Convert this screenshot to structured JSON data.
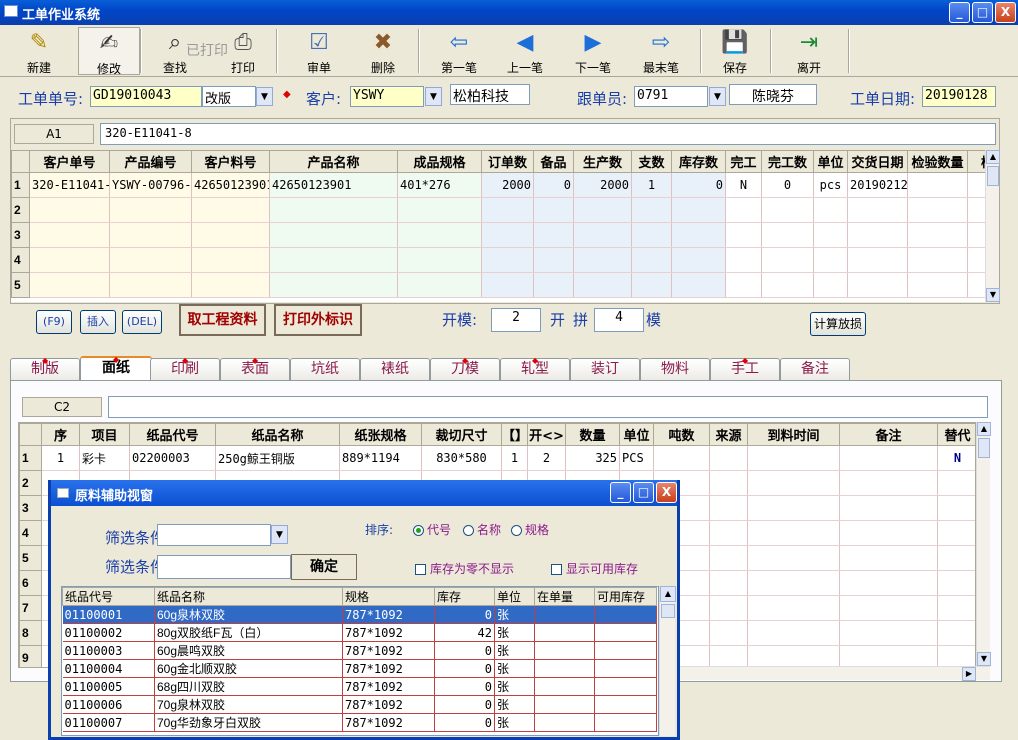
{
  "window": {
    "title": "工单作业系统",
    "minimize": "_",
    "maximize": "□",
    "close": "X"
  },
  "toolbar": [
    {
      "label": "新建",
      "icon": "new-icon"
    },
    {
      "label": "修改",
      "icon": "edit-icon"
    },
    {
      "label": "查找",
      "icon": "binoculars-icon"
    },
    {
      "label": "打印",
      "icon": "print-icon"
    },
    {
      "label": "审单",
      "icon": "review-icon"
    },
    {
      "label": "删除",
      "icon": "delete-icon"
    },
    {
      "label": "第一笔",
      "icon": "first-arrow-icon"
    },
    {
      "label": "上一笔",
      "icon": "prev-arrow-icon"
    },
    {
      "label": "下一笔",
      "icon": "next-arrow-icon"
    },
    {
      "label": "最末笔",
      "icon": "last-arrow-icon"
    },
    {
      "label": "保存",
      "icon": "save-icon"
    },
    {
      "label": "离开",
      "icon": "exit-icon"
    }
  ],
  "printed_watermark": "已打印",
  "header": {
    "order_no_label": "工单单号:",
    "order_no": "GD19010043",
    "mode": "改版",
    "customer_label": "客户:",
    "customer_code": "YSWY",
    "customer_name": "松柏科技",
    "follower_label": "跟单员:",
    "follower_code": "0791",
    "follower_name": "陈晓芬",
    "date_label": "工单日期:",
    "date": "20190128"
  },
  "top_grid": {
    "cell_ref": "A1",
    "cell_value": "320-E11041-8",
    "columns": [
      "",
      "客户单号",
      "产品编号",
      "客户料号",
      "产品名称",
      "成品规格",
      "订单数",
      "备品",
      "生产数",
      "支数",
      "库存数",
      "完工",
      "完工数",
      "单位",
      "交货日期",
      "检验数量",
      "检"
    ],
    "rows": [
      [
        "1",
        "320-E11041-",
        "YSWY-00796-",
        "42650123901",
        "42650123901",
        "401*276",
        "2000",
        "0",
        "2000",
        "1",
        "0",
        "N",
        "0",
        "pcs",
        "20190212",
        "",
        ""
      ],
      [
        "2",
        "",
        "",
        "",
        "",
        "",
        "",
        "",
        "",
        "",
        "",
        "",
        "",
        "",
        "",
        "",
        ""
      ],
      [
        "3",
        "",
        "",
        "",
        "",
        "",
        "",
        "",
        "",
        "",
        "",
        "",
        "",
        "",
        "",
        "",
        ""
      ],
      [
        "4",
        "",
        "",
        "",
        "",
        "",
        "",
        "",
        "",
        "",
        "",
        "",
        "",
        "",
        "",
        "",
        ""
      ],
      [
        "5",
        "",
        "",
        "",
        "",
        "",
        "",
        "",
        "",
        "",
        "",
        "",
        "",
        "",
        "",
        "",
        ""
      ]
    ]
  },
  "actions": {
    "f9": "(F9)",
    "insert": "插入",
    "del": "(DEL)",
    "get_process": "取工程资料",
    "print_label": "打印外标识",
    "open_mold_label": "开模:",
    "open_mold": "2",
    "open_label": "开",
    "combine_label": "拼",
    "combine": "4",
    "mold_label": "模",
    "calc_loss": "计算放损"
  },
  "tabs": [
    {
      "label": "制版",
      "dot": true
    },
    {
      "label": "面纸",
      "dot": true,
      "active": true
    },
    {
      "label": "印刷",
      "dot": true
    },
    {
      "label": "表面",
      "dot": true
    },
    {
      "label": "坑纸",
      "dot": false
    },
    {
      "label": "裱纸",
      "dot": false
    },
    {
      "label": "刀模",
      "dot": true
    },
    {
      "label": "轧型",
      "dot": true
    },
    {
      "label": "装订",
      "dot": false
    },
    {
      "label": "物料",
      "dot": false
    },
    {
      "label": "手工",
      "dot": true
    },
    {
      "label": "备注",
      "dot": false
    }
  ],
  "bottom_grid": {
    "cell_ref": "C2",
    "cell_value": "",
    "columns": [
      "",
      "序",
      "项目",
      "纸品代号",
      "纸品名称",
      "纸张规格",
      "裁切尺寸",
      "【】",
      "开<>",
      "数量",
      "单位",
      "吨数",
      "来源",
      "到料时间",
      "备注",
      "替代"
    ],
    "rows": [
      [
        "1",
        "1",
        "彩卡",
        "02200003",
        "250g鲸王铜版",
        "889*1194",
        "830*580",
        "1",
        "2",
        "325",
        "PCS",
        "",
        "",
        "",
        "",
        "N"
      ],
      [
        "2"
      ],
      [
        "3"
      ],
      [
        "4"
      ],
      [
        "5"
      ],
      [
        "6"
      ],
      [
        "7"
      ],
      [
        "8"
      ],
      [
        "9"
      ]
    ]
  },
  "popup": {
    "title": "原料辅助视窗",
    "filter1_label": "筛选条件:",
    "filter2_label": "筛选条件:",
    "confirm": "确定",
    "sort_label": "排序:",
    "sort_options": [
      "代号",
      "名称",
      "规格"
    ],
    "sort_selected": 0,
    "hide_zero": "库存为零不显示",
    "show_available": "显示可用库存",
    "columns": [
      "纸品代号",
      "纸品名称",
      "规格",
      "库存",
      "单位",
      "在单量",
      "可用库存"
    ],
    "rows": [
      [
        "01100001",
        "60g泉林双胶",
        "787*1092",
        "0",
        "张",
        "",
        ""
      ],
      [
        "01100002",
        "80g双胶纸F瓦（白）",
        "787*1092",
        "42",
        "张",
        "",
        ""
      ],
      [
        "01100003",
        "60g晨鸣双胶",
        "787*1092",
        "0",
        "张",
        "",
        ""
      ],
      [
        "01100004",
        "60g金北顺双胶",
        "787*1092",
        "0",
        "张",
        "",
        ""
      ],
      [
        "01100005",
        "68g四川双胶",
        "787*1092",
        "0",
        "张",
        "",
        ""
      ],
      [
        "01100006",
        "70g泉林双胶",
        "787*1092",
        "0",
        "张",
        "",
        ""
      ],
      [
        "01100007",
        "70g华劲象牙白双胶",
        "787*1092",
        "0",
        "张",
        "",
        ""
      ]
    ]
  }
}
